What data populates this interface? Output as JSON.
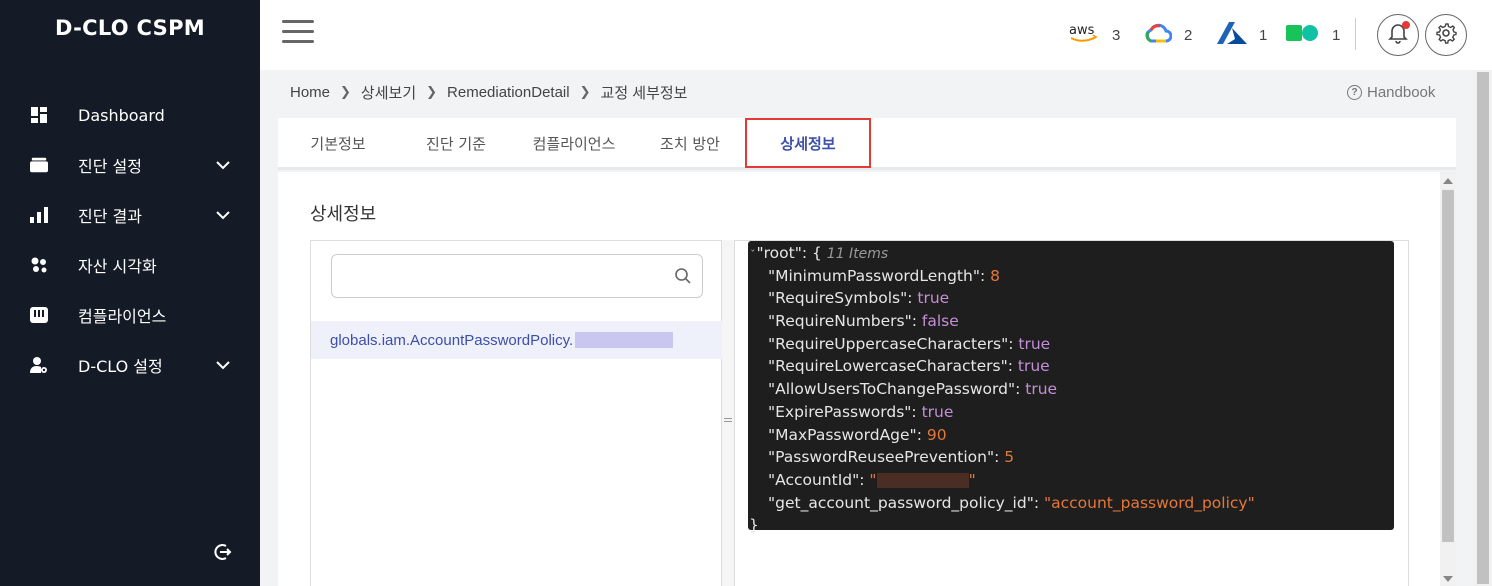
{
  "app": {
    "brand": "D-CLO CSPM"
  },
  "sidebar": {
    "items": [
      {
        "label": "Dashboard",
        "icon": "dashboard-grid-icon",
        "has_children": false
      },
      {
        "label": "진단 설정",
        "icon": "folder-icon",
        "has_children": true
      },
      {
        "label": "진단 결과",
        "icon": "bar-chart-icon",
        "has_children": true
      },
      {
        "label": "자산 시각화",
        "icon": "network-nodes-icon",
        "has_children": false
      },
      {
        "label": "컴플라이언스",
        "icon": "compliance-icon",
        "has_children": false
      },
      {
        "label": "D-CLO 설정",
        "icon": "user-settings-icon",
        "has_children": true
      }
    ]
  },
  "header": {
    "clouds": [
      {
        "name": "aws",
        "count": "3"
      },
      {
        "name": "gcp",
        "count": "2"
      },
      {
        "name": "azure",
        "count": "1"
      },
      {
        "name": "ncp",
        "count": "1"
      }
    ]
  },
  "breadcrumb": [
    "Home",
    "상세보기",
    "RemediationDetail",
    "교정 세부정보"
  ],
  "handbook": {
    "label": "Handbook"
  },
  "tabs": [
    {
      "label": "기본정보",
      "active": false
    },
    {
      "label": "진단 기준",
      "active": false
    },
    {
      "label": "컴플라이언스",
      "active": false
    },
    {
      "label": "조치 방안",
      "active": false
    },
    {
      "label": "상세정보",
      "active": true
    }
  ],
  "detail": {
    "title": "상세정보",
    "search": {
      "placeholder": "",
      "value": ""
    },
    "list_item": "globals.iam.AccountPasswordPolicy."
  },
  "json_view": {
    "root_key": "\"root\"",
    "root_open": ": {",
    "root_meta": "11 Items",
    "entries": [
      {
        "key": "\"MinimumPasswordLength\"",
        "value": "8",
        "type": "num"
      },
      {
        "key": "\"RequireSymbols\"",
        "value": "true",
        "type": "bool"
      },
      {
        "key": "\"RequireNumbers\"",
        "value": "false",
        "type": "bool"
      },
      {
        "key": "\"RequireUppercaseCharacters\"",
        "value": "true",
        "type": "bool"
      },
      {
        "key": "\"RequireLowercaseCharacters\"",
        "value": "true",
        "type": "bool"
      },
      {
        "key": "\"AllowUsersToChangePassword\"",
        "value": "true",
        "type": "bool"
      },
      {
        "key": "\"ExpirePasswords\"",
        "value": "true",
        "type": "bool"
      },
      {
        "key": "\"MaxPasswordAge\"",
        "value": "90",
        "type": "num"
      },
      {
        "key": "\"PasswordReuseePrevention\"",
        "value": "5",
        "type": "num"
      },
      {
        "key": "\"AccountId\"",
        "value": "redacted",
        "type": "redacted"
      },
      {
        "key": "\"get_account_password_policy_id\"",
        "value": "\"account_password_policy\"",
        "type": "str"
      }
    ],
    "close": "}"
  },
  "colors": {
    "sidebar_bg": "#141a26",
    "accent": "#3d4fa8",
    "active_outline": "#e53935",
    "json_bg": "#1e1e1e",
    "json_number": "#e5773a",
    "json_bool": "#c48fd6"
  }
}
